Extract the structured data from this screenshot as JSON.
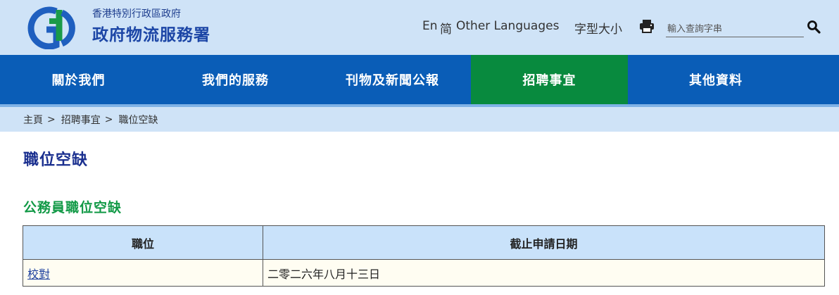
{
  "header": {
    "logo_icon": "ggd-logo-icon",
    "org_name_small": "香港特別行政區政府",
    "org_name_large": "政府物流服務署",
    "lang_en": "En",
    "lang_sc": "简",
    "lang_other": "Other Languages",
    "font_size_label": "字型大小",
    "print_icon": "printer-icon",
    "search": {
      "placeholder": "輸入查詢字串",
      "value": ""
    },
    "search_icon": "magnifier-icon"
  },
  "nav": {
    "items": [
      {
        "label": "關於我們"
      },
      {
        "label": "我們的服務"
      },
      {
        "label": "刊物及新聞公報"
      },
      {
        "label": "招聘事宜",
        "active": true
      },
      {
        "label": "其他資料"
      }
    ]
  },
  "breadcrumb": [
    "主頁",
    "招聘事宜",
    "職位空缺"
  ],
  "breadcrumb_separator": ">",
  "page": {
    "title": "職位空缺",
    "section_title": "公務員職位空缺"
  },
  "table": {
    "headers": [
      "職位",
      "截止申請日期"
    ],
    "rows": [
      {
        "position": "校對",
        "deadline": "二零二六年八月十三日"
      }
    ]
  },
  "colors": {
    "header_bg": "#cfe3f7",
    "nav_bg": "#0a5db7",
    "nav_active_bg": "#088a3e",
    "title_color": "#1a2f8f",
    "section_title_color": "#119946",
    "table_header_bg": "#c9e2fa",
    "table_row_bg": "#fffdf2"
  }
}
